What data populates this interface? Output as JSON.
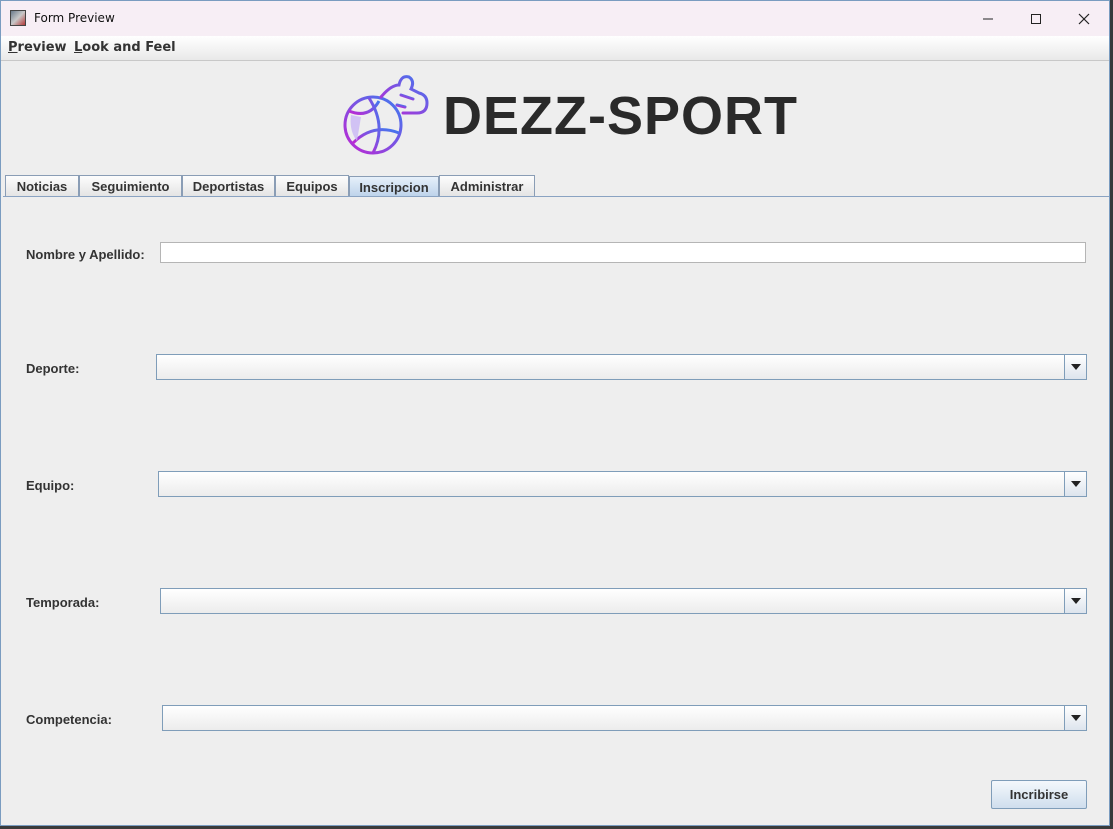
{
  "window": {
    "title": "Form Preview"
  },
  "menu": [
    {
      "label": "review",
      "mnemonic": "P"
    },
    {
      "label": "ook and Feel",
      "mnemonic": "L"
    }
  ],
  "brand": {
    "name": "DEZZ-SPORT"
  },
  "tabs": [
    "Noticias",
    "Seguimiento",
    "Deportistas",
    "Equipos",
    "Inscripcion",
    "Administrar"
  ],
  "active_tab": "Inscripcion",
  "form": {
    "name_label": "Nombre y Apellido:",
    "name_value": "",
    "sport_label": "Deporte:",
    "sport_value": "",
    "team_label": "Equipo:",
    "team_value": "",
    "season_label": "Temporada:",
    "season_value": "",
    "competition_label": "Competencia:",
    "competition_value": "",
    "submit_label": "Incribirse"
  },
  "colors": {
    "logo_gradient_start": "#3d7bf0",
    "logo_gradient_end": "#c026d3",
    "tab_active": "#bcd2ea"
  }
}
